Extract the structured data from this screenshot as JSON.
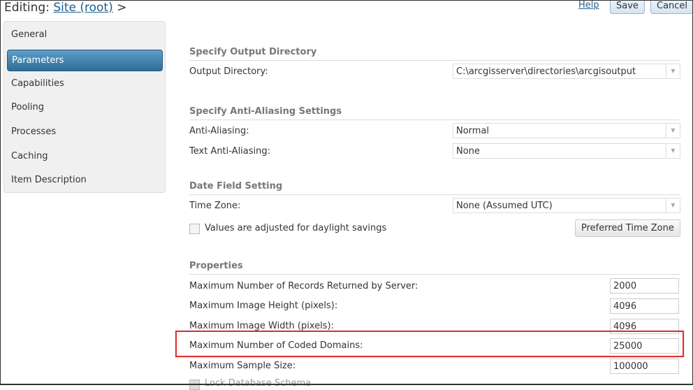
{
  "header": {
    "editing_label": "Editing:",
    "site_link": "Site (root)",
    "separator": ">",
    "help": "Help",
    "save": "Save",
    "cancel": "Cancel"
  },
  "sidebar": {
    "items": [
      {
        "label": "General"
      },
      {
        "label": "Parameters"
      },
      {
        "label": "Capabilities"
      },
      {
        "label": "Pooling"
      },
      {
        "label": "Processes"
      },
      {
        "label": "Caching"
      },
      {
        "label": "Item Description"
      }
    ]
  },
  "output": {
    "section": "Specify Output Directory",
    "label": "Output Directory:",
    "value": "C:\\arcgisserver\\directories\\arcgisoutput"
  },
  "antialias": {
    "section": "Specify Anti-Aliasing Settings",
    "aa_label": "Anti-Aliasing:",
    "aa_value": "Normal",
    "text_label": "Text Anti-Aliasing:",
    "text_value": "None"
  },
  "date": {
    "section": "Date Field Setting",
    "tz_label": "Time Zone:",
    "tz_value": "None (Assumed UTC)",
    "dst_label": "Values are adjusted for daylight savings",
    "preferred_button": "Preferred Time Zone"
  },
  "properties": {
    "section": "Properties",
    "rows": [
      {
        "label": "Maximum Number of Records Returned by Server:",
        "value": "2000"
      },
      {
        "label": "Maximum Image Height (pixels):",
        "value": "4096"
      },
      {
        "label": "Maximum Image Width (pixels):",
        "value": "4096"
      },
      {
        "label": "Maximum Number of Coded Domains:",
        "value": "25000"
      },
      {
        "label": "Maximum Sample Size:",
        "value": "100000"
      }
    ],
    "lock_label": "Lock Database Schema"
  }
}
